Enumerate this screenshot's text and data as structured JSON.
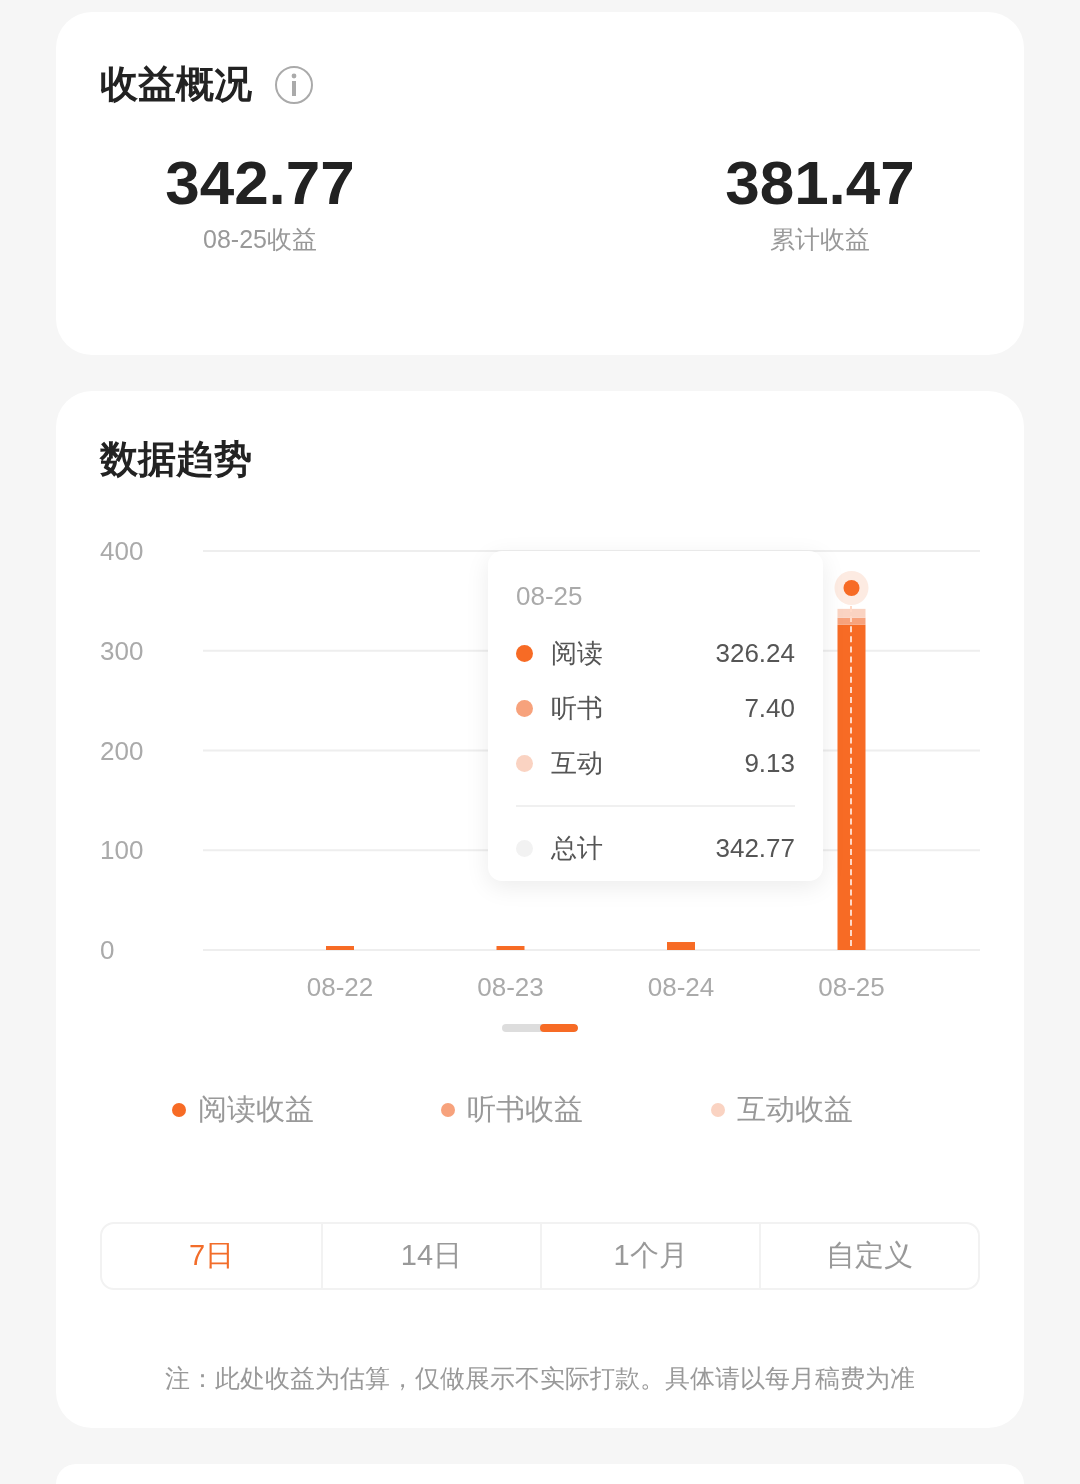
{
  "overview": {
    "title": "收益概况",
    "stats": [
      {
        "value": "342.77",
        "label": "08-25收益"
      },
      {
        "value": "381.47",
        "label": "累计收益"
      }
    ]
  },
  "trend": {
    "title": "数据趋势",
    "chart_data": {
      "type": "bar",
      "stacked": true,
      "grid": true,
      "categories": [
        "08-22",
        "08-23",
        "08-24",
        "08-25"
      ],
      "ylim": [
        0,
        400
      ],
      "yticks": [
        0,
        100,
        200,
        300,
        400
      ],
      "series": [
        {
          "name": "阅读收益",
          "color": "#f76b25",
          "values": [
            4,
            4,
            8,
            326
          ]
        },
        {
          "name": "听书收益",
          "color": "#f7a27c",
          "values": [
            0,
            0,
            0,
            7
          ]
        },
        {
          "name": "互动收益",
          "color": "#fad3c2",
          "values": [
            0,
            0,
            0,
            9
          ]
        }
      ]
    },
    "tooltip": {
      "date": "08-25",
      "rows": [
        {
          "label": "阅读",
          "value": "326.24",
          "color": "#f76b25"
        },
        {
          "label": "听书",
          "value": "7.40",
          "color": "#f7a27c"
        },
        {
          "label": "互动",
          "value": "9.13",
          "color": "#fad3c2"
        }
      ],
      "total_label": "总计",
      "total_value": "342.77"
    },
    "ranges": [
      {
        "label": "7日",
        "selected": true
      },
      {
        "label": "14日",
        "selected": false
      },
      {
        "label": "1个月",
        "selected": false
      },
      {
        "label": "自定义",
        "selected": false
      }
    ],
    "note": "注：此处收益为估算，仅做展示不实际打款。具体请以每月稿费为准"
  }
}
